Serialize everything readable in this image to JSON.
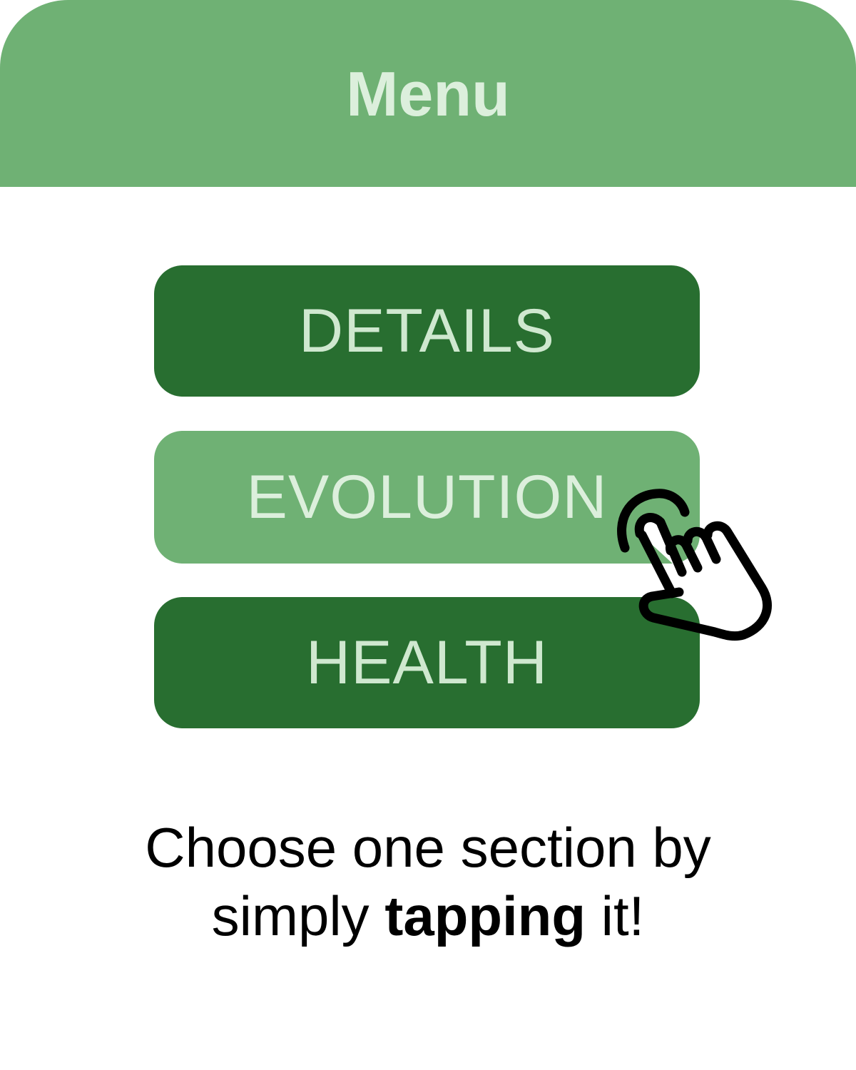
{
  "header": {
    "title": "Menu",
    "background_color": "#6fb174"
  },
  "menu": {
    "items": [
      {
        "label": "DETAILS",
        "state": "default",
        "color": "#286e30"
      },
      {
        "label": "EVOLUTION",
        "state": "pressed",
        "color": "#6fb174"
      },
      {
        "label": "HEALTH",
        "state": "default",
        "color": "#286e30"
      }
    ],
    "text_color": "#cfe8cf"
  },
  "pointer": {
    "icon": "tap-hand-icon"
  },
  "instruction": {
    "line1": "Choose one section by",
    "line2_prefix": "simply ",
    "line2_bold": "tapping",
    "line2_suffix": " it!"
  }
}
